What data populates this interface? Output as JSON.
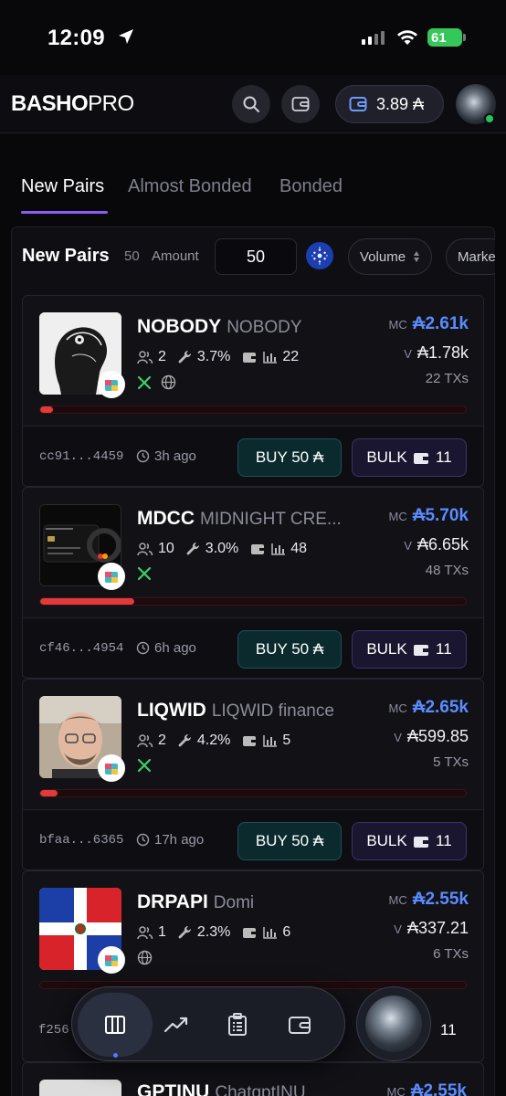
{
  "status_bar": {
    "time": "12:09",
    "battery": "61"
  },
  "header": {
    "logo_main": "BASHO",
    "logo_accent": "PRO",
    "balance": "3.89 ₳"
  },
  "tabs": [
    {
      "label": "New Pairs",
      "active": true
    },
    {
      "label": "Almost Bonded",
      "active": false
    },
    {
      "label": "Bonded",
      "active": false
    }
  ],
  "filter_bar": {
    "title": "New Pairs",
    "count": "50",
    "amount_label": "Amount",
    "amount_value": "50",
    "sort_label": "Volume",
    "market_label": "Marke"
  },
  "labels": {
    "mc": "MC",
    "v": "V",
    "buy": "BUY 50 ₳",
    "bulk": "BULK"
  },
  "tokens": [
    {
      "symbol": "NOBODY",
      "name": "NOBODY",
      "holders": "2",
      "dev_pct": "3.7%",
      "bars": "22",
      "mc": "₳2.61k",
      "volume": "₳1.78k",
      "txs": "22 TXs",
      "address": "cc91...4459",
      "age": "3h ago",
      "bulk_count": "11",
      "progress": 0.03,
      "socials": [
        "x",
        "web"
      ]
    },
    {
      "symbol": "MDCC",
      "name": "MIDNIGHT CRE...",
      "holders": "10",
      "dev_pct": "3.0%",
      "bars": "48",
      "mc": "₳5.70k",
      "volume": "₳6.65k",
      "txs": "48 TXs",
      "address": "cf46...4954",
      "age": "6h ago",
      "bulk_count": "11",
      "progress": 0.22,
      "socials": [
        "x"
      ]
    },
    {
      "symbol": "LIQWID",
      "name": "LIQWID finance",
      "holders": "2",
      "dev_pct": "4.2%",
      "bars": "5",
      "mc": "₳2.65k",
      "volume": "₳599.85",
      "txs": "5 TXs",
      "address": "bfaa...6365",
      "age": "17h ago",
      "bulk_count": "11",
      "progress": 0.04,
      "socials": [
        "x"
      ]
    },
    {
      "symbol": "DRPAPI",
      "name": "Domi",
      "holders": "1",
      "dev_pct": "2.3%",
      "bars": "6",
      "mc": "₳2.55k",
      "volume": "₳337.21",
      "txs": "6 TXs",
      "address": "f256",
      "age": "",
      "bulk_count": "11",
      "progress": 0.0,
      "socials": [
        "web"
      ]
    }
  ],
  "partial_card": {
    "symbol": "GPTINU",
    "name": "ChatgptINU",
    "mc": "₳2.55k"
  },
  "colors": {
    "accent": "#8b5cf6",
    "mc_blue": "#5b8cff",
    "progress_red": "#e03a3a",
    "online": "#22c55e"
  }
}
